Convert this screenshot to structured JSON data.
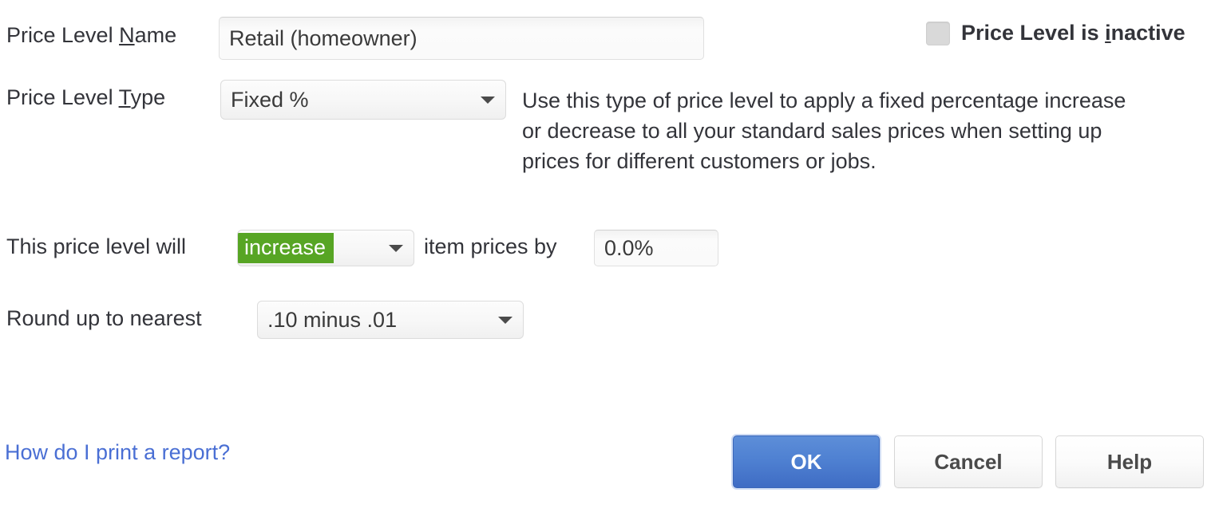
{
  "dialog": {
    "name_label": {
      "before": "Price Level ",
      "accel": "N",
      "after": "ame"
    },
    "name_value": "Retail (homeowner)",
    "type_label": {
      "before": "Price Level ",
      "accel": "T",
      "after": "ype"
    },
    "type_value": "Fixed %",
    "inactive_checkbox": {
      "before": "Price Level is ",
      "accel": "i",
      "after": "nactive",
      "checked": false
    },
    "description": [
      "Use this type of price level to apply a fixed percentage increase",
      "or decrease to all your standard sales prices when setting up",
      "prices for different customers or jobs."
    ],
    "adjust_row": {
      "prefix_label": "This price level will",
      "direction_value": "increase",
      "middle_label": "item prices by",
      "amount_value": "0.0%"
    },
    "round_row": {
      "label": "Round up to nearest",
      "value": ".10 minus .01"
    },
    "help_link": "How do I print a report?",
    "buttons": {
      "ok": "OK",
      "cancel": "Cancel",
      "help": "Help"
    },
    "colors": {
      "selection_green": "#57a524",
      "primary_blue": "#4f81d2",
      "link_blue": "#4a6fd4"
    }
  }
}
